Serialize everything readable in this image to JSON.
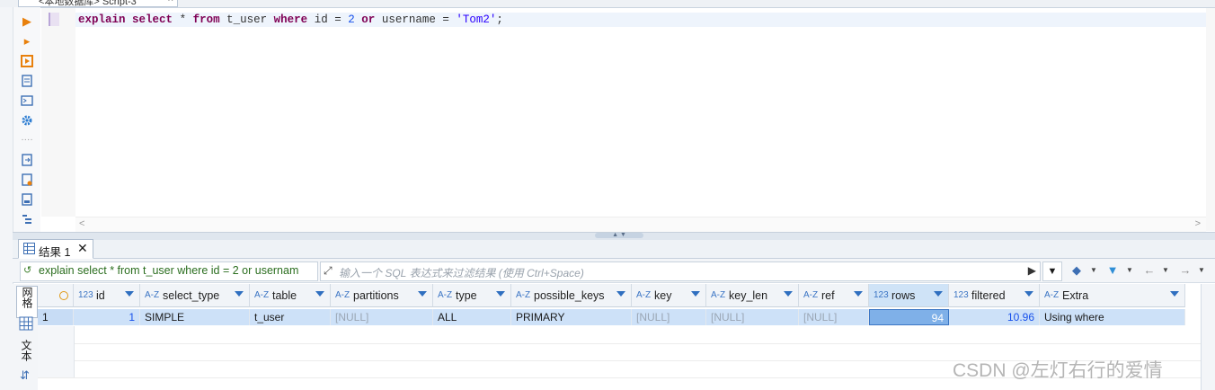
{
  "editor": {
    "tab_title": "<本地数据库> Script-3",
    "tab_close": "×",
    "sql": {
      "kw_explain": "explain",
      "kw_select": "select",
      "star": "*",
      "kw_from": "from",
      "table": "t_user",
      "kw_where": "where",
      "col_id": "id",
      "eq": "=",
      "val_id": "2",
      "kw_or": "or",
      "col_username": "username",
      "val_username": "'Tom2'",
      "semicolon": ";"
    },
    "scroll_left": "<",
    "scroll_right": ">"
  },
  "results": {
    "tab_label": "结果 1",
    "tab_close": "✕",
    "query_text": "explain select * from t_user where id = 2 or usernam",
    "filter_placeholder": "输入一个 SQL 表达式来过滤结果 (使用 Ctrl+Space)",
    "left_tabs": {
      "grid": "网格",
      "text": "文本"
    },
    "columns": [
      {
        "type": "123",
        "name": "id"
      },
      {
        "type": "A-Z",
        "name": "select_type"
      },
      {
        "type": "A-Z",
        "name": "table"
      },
      {
        "type": "A-Z",
        "name": "partitions"
      },
      {
        "type": "A-Z",
        "name": "type"
      },
      {
        "type": "A-Z",
        "name": "possible_keys"
      },
      {
        "type": "A-Z",
        "name": "key"
      },
      {
        "type": "A-Z",
        "name": "key_len"
      },
      {
        "type": "A-Z",
        "name": "ref"
      },
      {
        "type": "123",
        "name": "rows"
      },
      {
        "type": "123",
        "name": "filtered"
      },
      {
        "type": "A-Z",
        "name": "Extra"
      }
    ],
    "rows": [
      {
        "rownum": "1",
        "cells": [
          "1",
          "SIMPLE",
          "t_user",
          "[NULL]",
          "ALL",
          "PRIMARY",
          "[NULL]",
          "[NULL]",
          "[NULL]",
          "94",
          "10.96",
          "Using where"
        ]
      }
    ]
  },
  "watermark": "CSDN @左灯右行的爱情",
  "colors": {
    "accent": "#2f6fc0",
    "selection": "#cde1f8",
    "keyword": "#7f0055"
  }
}
